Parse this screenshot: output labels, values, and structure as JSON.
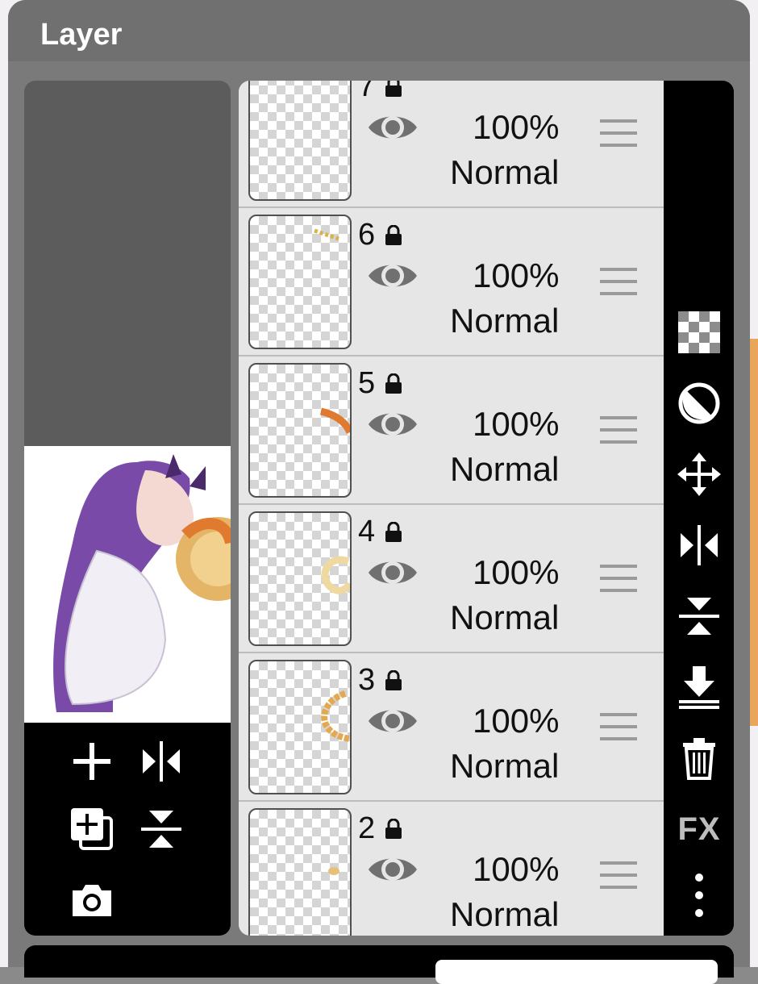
{
  "window": {
    "title": "Layer"
  },
  "layers": [
    {
      "number": "7",
      "opacity": "100%",
      "blend_mode": "Normal"
    },
    {
      "number": "6",
      "opacity": "100%",
      "blend_mode": "Normal"
    },
    {
      "number": "5",
      "opacity": "100%",
      "blend_mode": "Normal"
    },
    {
      "number": "4",
      "opacity": "100%",
      "blend_mode": "Normal"
    },
    {
      "number": "3",
      "opacity": "100%",
      "blend_mode": "Normal"
    },
    {
      "number": "2",
      "opacity": "100%",
      "blend_mode": "Normal"
    }
  ],
  "left_tools": [
    "add-layer-icon",
    "flip-horizontal-icon",
    "duplicate-layer-icon",
    "flip-vertical-icon",
    "camera-icon"
  ],
  "right_tools": {
    "items": [
      "transparency-checker-icon",
      "opacity-icon",
      "move-icon",
      "flip-horizontal-icon",
      "flip-vertical-icon",
      "merge-down-icon",
      "trash-icon",
      "fx-icon",
      "more-icon"
    ],
    "fx_label": "FX"
  },
  "colors": {
    "panel": "#7a7a7a",
    "row": "#e6e6e6",
    "toolbar": "#000000",
    "title": "#ffffff"
  }
}
